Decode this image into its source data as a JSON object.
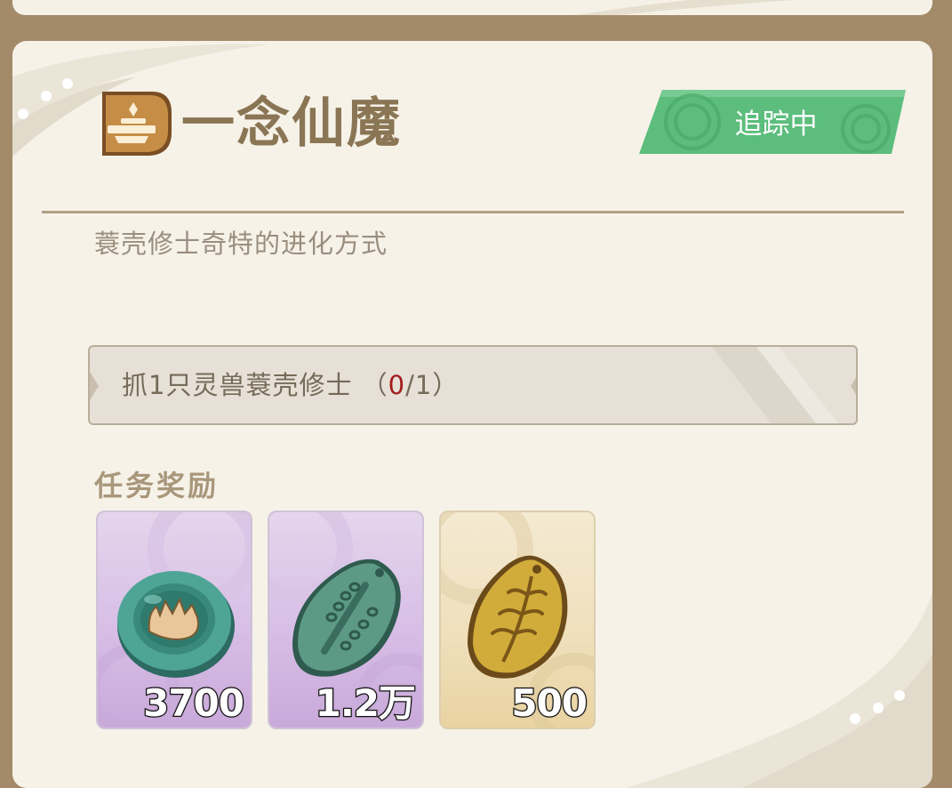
{
  "quest": {
    "title": "一念仙魔",
    "icon": "ceremony-altar-icon",
    "track_label": "追踪中",
    "description": "蓑壳修士奇特的进化方式"
  },
  "objective": {
    "prefix": "抓1只灵兽蓑壳修士 （",
    "current": "0",
    "suffix": "/1）"
  },
  "rewards": {
    "title": "任务奖励",
    "items": [
      {
        "icon": "jade-coin-icon",
        "count": "3700",
        "rarity": "purple"
      },
      {
        "icon": "jade-token-icon",
        "count": "1.2万",
        "rarity": "purple"
      },
      {
        "icon": "gold-leaf-token-icon",
        "count": "500",
        "rarity": "gold"
      }
    ]
  },
  "colors": {
    "frame": "#a38a68",
    "panel": "#f6f2e8",
    "title": "#8a7554",
    "track_green": "#58b878",
    "progress_current": "#a41c1c"
  }
}
